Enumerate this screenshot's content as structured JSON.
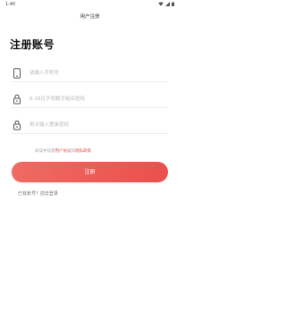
{
  "status_bar": {
    "time": "1:40"
  },
  "header": {
    "title": "用户注册"
  },
  "page_title": "注册账号",
  "form": {
    "phone": {
      "placeholder": "请输入手机号"
    },
    "password": {
      "placeholder": "6-16位字母数字组合密码"
    },
    "confirm_password": {
      "placeholder": "再次输入登录密码"
    }
  },
  "agreement": {
    "prefix": "阅读并同意",
    "user_agreement": "用户协议",
    "connector": "和",
    "privacy_policy": "隐私政策"
  },
  "register_button": "注册",
  "login_link": "已有账号？前去登录",
  "colors": {
    "accent": "#EA4F4D",
    "link": "#E8504D"
  },
  "icons": {
    "phone": "phone-icon",
    "lock": "lock-icon"
  }
}
